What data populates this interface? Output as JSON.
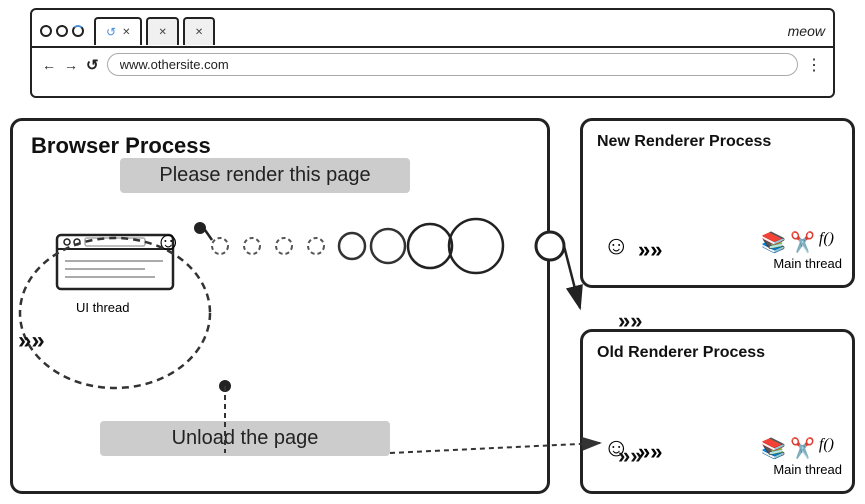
{
  "browser": {
    "tabs": [
      {
        "label": "",
        "active": true,
        "loading": true
      },
      {
        "label": "",
        "active": false
      },
      {
        "label": "",
        "active": false
      }
    ],
    "meow_label": "meow",
    "address": "www.othersite.com",
    "nav_back": "←",
    "nav_forward": "→",
    "nav_refresh": "c",
    "more": "⋮"
  },
  "diagram": {
    "browser_process_label": "Browser Process",
    "new_renderer_label": "New Renderer Process",
    "old_renderer_label": "Old Renderer Process",
    "ui_thread_label": "UI thread",
    "main_thread_label_new": "Main thread",
    "main_thread_label_old": "Main thread",
    "message_render": "Please render this page",
    "message_unload": "Unload the page"
  }
}
